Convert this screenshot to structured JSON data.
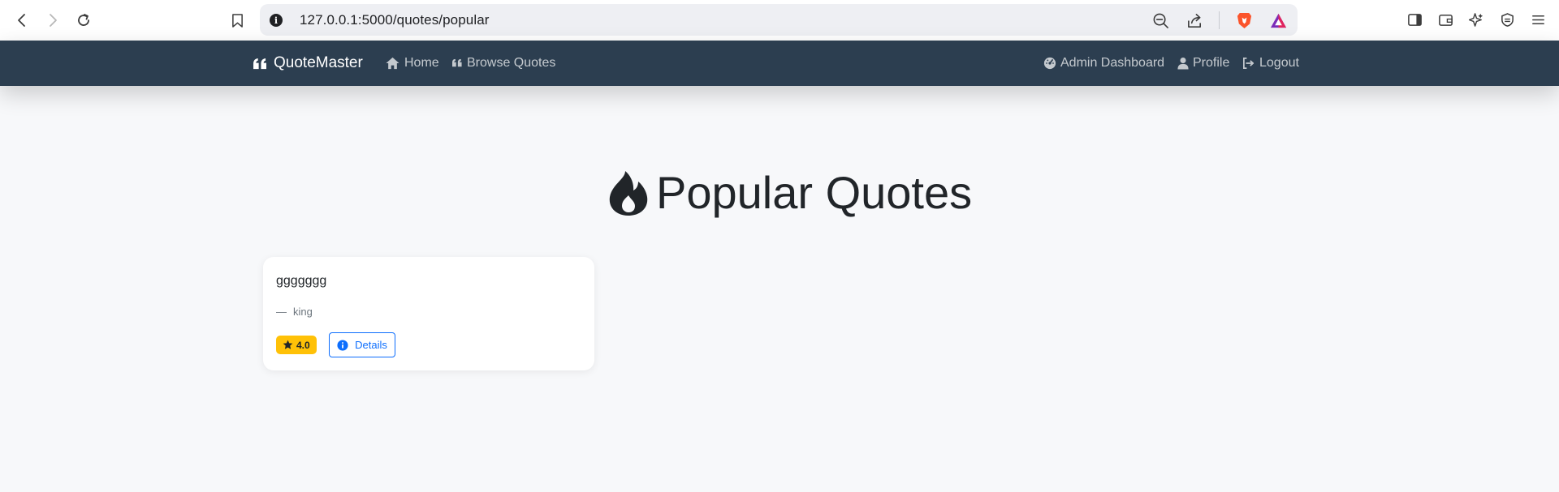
{
  "browser": {
    "url": "127.0.0.1:5000/quotes/popular",
    "url_info_glyph": "i"
  },
  "navbar": {
    "brand": "QuoteMaster",
    "links": [
      {
        "label": "Home"
      },
      {
        "label": "Browse Quotes"
      }
    ],
    "right_links": [
      {
        "label": "Admin Dashboard"
      },
      {
        "label": "Profile"
      },
      {
        "label": "Logout"
      }
    ]
  },
  "main": {
    "title": "Popular Quotes",
    "quotes": [
      {
        "text": "ggggggg",
        "dash": "—",
        "author": "king",
        "rating": "4.0",
        "details_label": "Details"
      }
    ]
  },
  "colors": {
    "navbar": "#2c3e50",
    "background": "#f7f8fa",
    "rating_badge": "#ffc107",
    "primary": "#0d6efd"
  },
  "icons": {
    "brand": "quote-left-icon",
    "home": "house-icon",
    "browse": "quote-icon",
    "admin": "gauge-icon",
    "profile": "user-icon",
    "logout": "sign-out-icon",
    "title": "fire-icon",
    "rating": "star-icon",
    "details": "info-circle-icon"
  }
}
